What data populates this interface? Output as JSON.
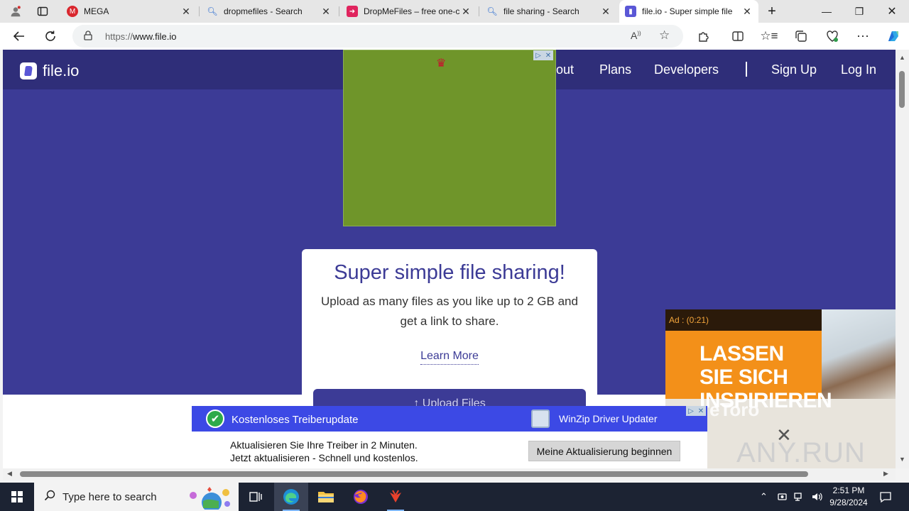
{
  "browser": {
    "tabs": [
      {
        "title": "MEGA",
        "favicon": "mega-icon",
        "color": "#d9272e"
      },
      {
        "title": "dropmefiles - Search",
        "favicon": "search-icon",
        "color": "#2b6cd1"
      },
      {
        "title": "DropMeFiles – free one-c",
        "favicon": "dropmefiles-icon",
        "color": "#e0245e"
      },
      {
        "title": "file sharing - Search",
        "favicon": "search-icon",
        "color": "#2b6cd1"
      },
      {
        "title": "file.io - Super simple file",
        "favicon": "fileio-icon",
        "color": "#5a57d6",
        "active": true
      }
    ],
    "new_tab": "+",
    "url_scheme": "https://",
    "url_host": "www.file.io"
  },
  "site": {
    "logo_text": "file.io",
    "nav": {
      "about": "About",
      "plans": "Plans",
      "developers": "Developers",
      "sign_up": "Sign Up",
      "log_in": "Log In"
    },
    "headline": "Super simple file sharing!",
    "subtext": "Upload as many files as you like up to 2 GB and get a link to share.",
    "learn_more": "Learn More",
    "upload_button": "↑  Upload Files",
    "colors": {
      "hero": "#3c3b96",
      "navbar": "#2f2e79",
      "accent": "#3c3b96"
    }
  },
  "ads": {
    "top_banner": {
      "background": "#6f952a"
    },
    "side_video": {
      "label": "Ad : (0:21)",
      "headline": "LASSEN SIE SICH INSPIRIEREN",
      "brand": "eToro",
      "watermark": "ANY.RUN"
    },
    "bottom_banner": {
      "headline": "Kostenloses Treiberupdate",
      "product": "WinZip Driver Updater",
      "line1": "Aktualisieren Sie Ihre Treiber in 2 Minuten.",
      "line2": "Jetzt aktualisieren - Schnell und kostenlos.",
      "cta": "Meine Aktualisierung beginnen"
    }
  },
  "taskbar": {
    "search_placeholder": "Type here to search",
    "time": "2:51 PM",
    "date": "9/28/2024",
    "apps": [
      "task-view",
      "edge",
      "file-explorer",
      "firefox",
      "anyrun-app"
    ]
  }
}
